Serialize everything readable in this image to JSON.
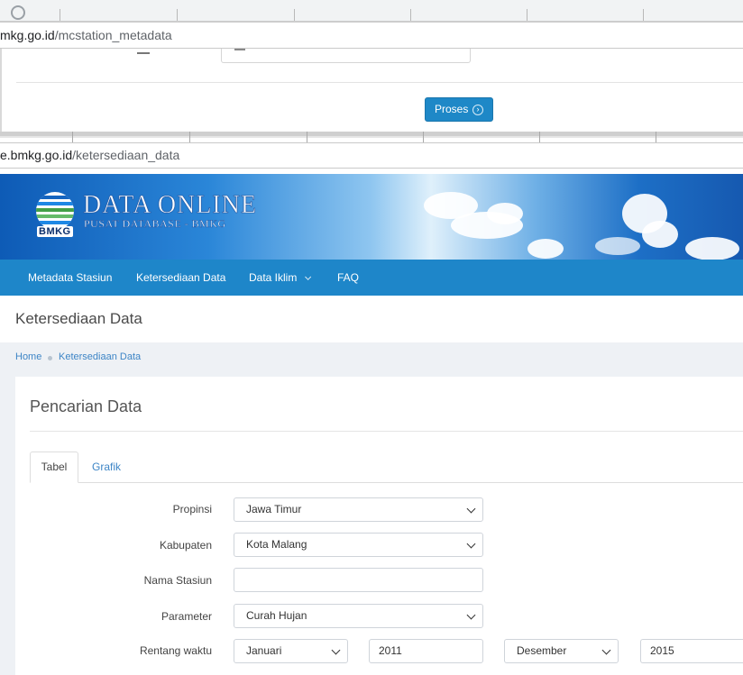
{
  "browser_top": {
    "url1_host": "mkg.go.id",
    "url1_path": "/mcstation_metadata",
    "url2_host": "e.bmkg.go.id",
    "url2_path": "/ketersediaan_data",
    "proses_label": "Proses"
  },
  "banner": {
    "logo_text": "BMKG",
    "title": "DATA ONLINE",
    "subtitle": "PUSAT DATABASE - BMKG"
  },
  "nav": {
    "items": [
      {
        "label": "Metadata Stasiun"
      },
      {
        "label": "Ketersediaan Data"
      },
      {
        "label": "Data Iklim"
      },
      {
        "label": "FAQ"
      }
    ]
  },
  "page": {
    "title": "Ketersediaan Data",
    "breadcrumb": [
      "Home",
      "Ketersediaan Data"
    ]
  },
  "card": {
    "title": "Pencarian Data",
    "tabs": [
      {
        "label": "Tabel",
        "active": true
      },
      {
        "label": "Grafik",
        "active": false
      }
    ]
  },
  "form": {
    "propinsi": {
      "label": "Propinsi",
      "value": "Jawa Timur"
    },
    "kabupaten": {
      "label": "Kabupaten",
      "value": "Kota Malang"
    },
    "nama_stasiun": {
      "label": "Nama Stasiun",
      "value": ""
    },
    "parameter": {
      "label": "Parameter",
      "value": "Curah Hujan"
    },
    "rentang_waktu": {
      "label": "Rentang waktu",
      "start_month": "Januari",
      "start_year": "2011",
      "end_month": "Desember",
      "end_year": "2015"
    }
  },
  "colors": {
    "nav_bg": "#1e86c9",
    "button_bg": "#1e88c7",
    "link": "#3d85c6",
    "page_bg": "#eef1f5"
  }
}
